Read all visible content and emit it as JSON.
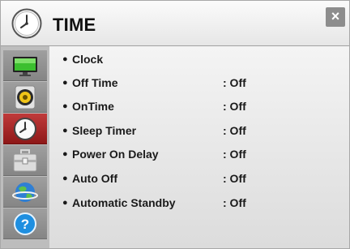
{
  "header": {
    "title": "TIME",
    "close_label": "×"
  },
  "sidebar": {
    "items": [
      {
        "icon": "picture-icon"
      },
      {
        "icon": "audio-speaker-icon"
      },
      {
        "icon": "time-clock-icon",
        "active": true
      },
      {
        "icon": "option-toolbox-icon"
      },
      {
        "icon": "network-globe-icon"
      },
      {
        "icon": "help-question-icon"
      }
    ]
  },
  "menu": {
    "bullet": "●",
    "items": [
      {
        "label": "Clock",
        "value": ""
      },
      {
        "label": "Off Time",
        "value": ": Off"
      },
      {
        "label": "OnTime",
        "value": ": Off"
      },
      {
        "label": "Sleep Timer",
        "value": ": Off"
      },
      {
        "label": "Power On Delay",
        "value": ": Off"
      },
      {
        "label": "Auto Off",
        "value": ": Off"
      },
      {
        "label": "Automatic Standby",
        "value": ": Off"
      }
    ]
  },
  "colors": {
    "active_tab": "#a82828",
    "sidebar": "#bdbdbd",
    "close_button": "#8d8d8d"
  }
}
